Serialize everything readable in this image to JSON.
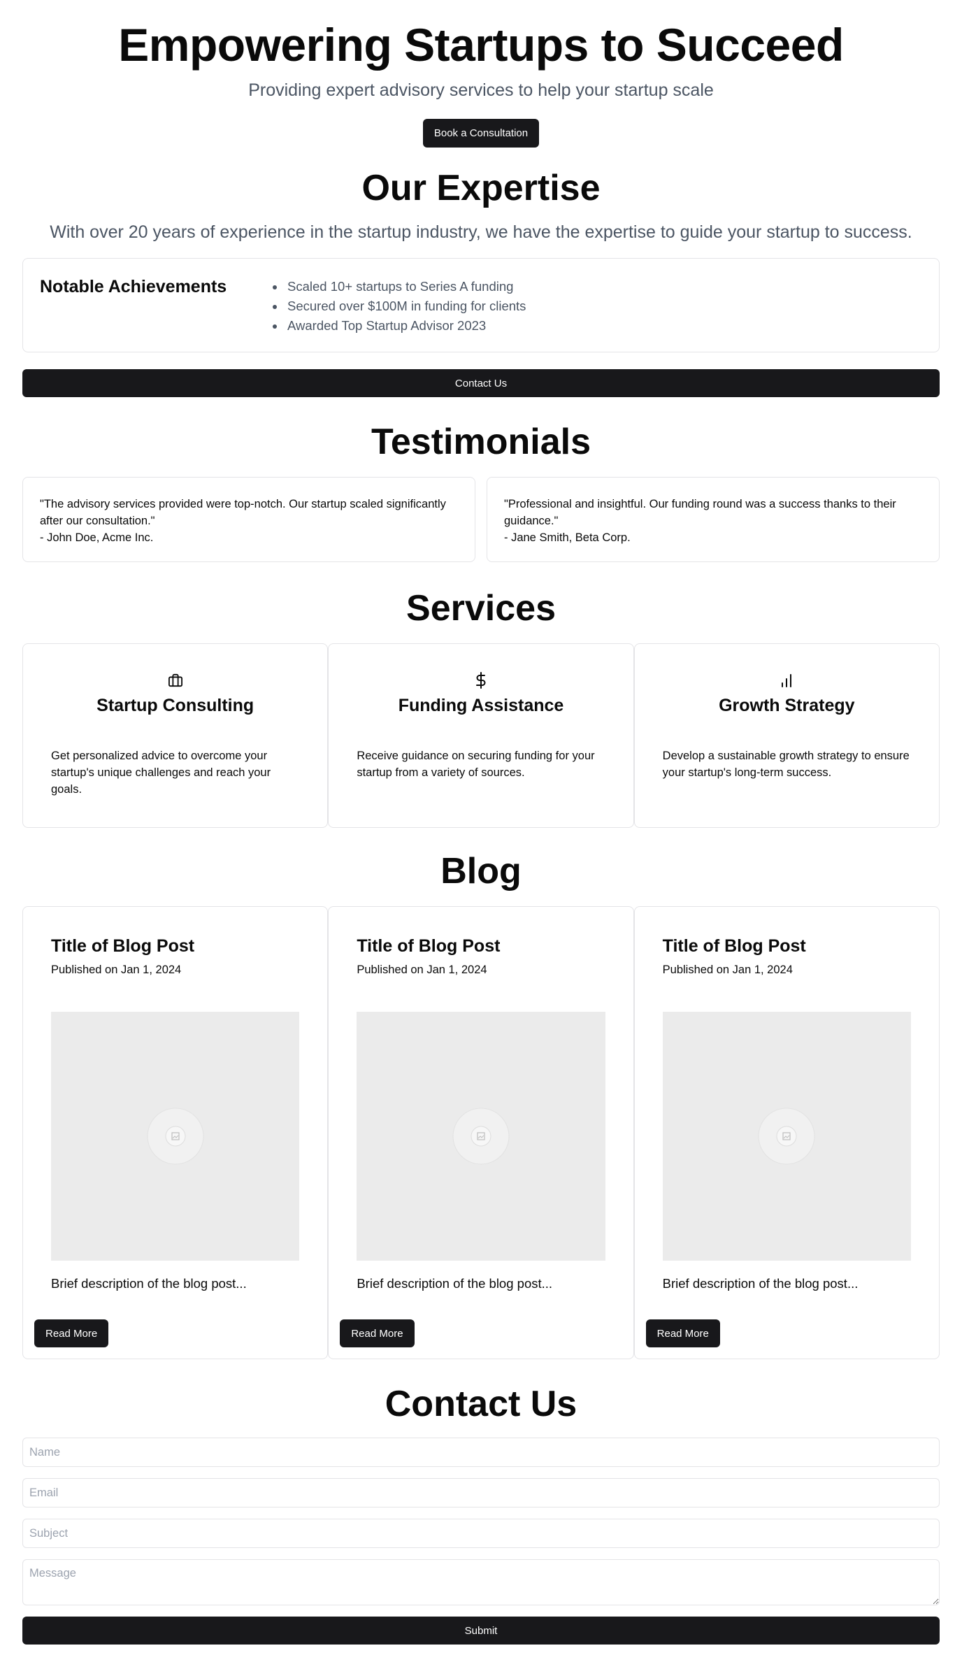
{
  "hero": {
    "title": "Empowering Startups to Succeed",
    "subtitle": "Providing expert advisory services to help your startup scale",
    "cta_label": "Book a Consultation"
  },
  "expertise": {
    "title": "Our Expertise",
    "lead": "With over 20 years of experience in the startup industry, we have the expertise to guide your startup to success.",
    "achievements_title": "Notable Achievements",
    "achievements": [
      "Scaled 10+ startups to Series A funding",
      "Secured over $100M in funding for clients",
      "Awarded Top Startup Advisor 2023"
    ],
    "contact_label": "Contact Us"
  },
  "testimonials": {
    "title": "Testimonials",
    "items": [
      {
        "quote": "\"The advisory services provided were top-notch. Our startup scaled significantly after our consultation.\"",
        "author": "- John Doe, Acme Inc."
      },
      {
        "quote": "\"Professional and insightful. Our funding round was a success thanks to their guidance.\"",
        "author": "- Jane Smith, Beta Corp."
      }
    ]
  },
  "services": {
    "title": "Services",
    "items": [
      {
        "icon": "briefcase-icon",
        "title": "Startup Consulting",
        "description": "Get personalized advice to overcome your startup's unique challenges and reach your goals."
      },
      {
        "icon": "dollar-icon",
        "title": "Funding Assistance",
        "description": "Receive guidance on securing funding for your startup from a variety of sources."
      },
      {
        "icon": "bar-chart-icon",
        "title": "Growth Strategy",
        "description": "Develop a sustainable growth strategy to ensure your startup's long-term success."
      }
    ]
  },
  "blog": {
    "title": "Blog",
    "posts": [
      {
        "title": "Title of Blog Post",
        "date": "Published on Jan 1, 2024",
        "description": "Brief description of the blog post...",
        "button_label": "Read More"
      },
      {
        "title": "Title of Blog Post",
        "date": "Published on Jan 1, 2024",
        "description": "Brief description of the blog post...",
        "button_label": "Read More"
      },
      {
        "title": "Title of Blog Post",
        "date": "Published on Jan 1, 2024",
        "description": "Brief description of the blog post...",
        "button_label": "Read More"
      }
    ]
  },
  "contact": {
    "title": "Contact Us",
    "name_placeholder": "Name",
    "email_placeholder": "Email",
    "subject_placeholder": "Subject",
    "message_placeholder": "Message",
    "submit_label": "Submit"
  },
  "colors": {
    "primary_button": "#18181b",
    "muted_text": "#4b5563",
    "border": "#e4e4e7",
    "image_placeholder": "#ebebeb"
  }
}
